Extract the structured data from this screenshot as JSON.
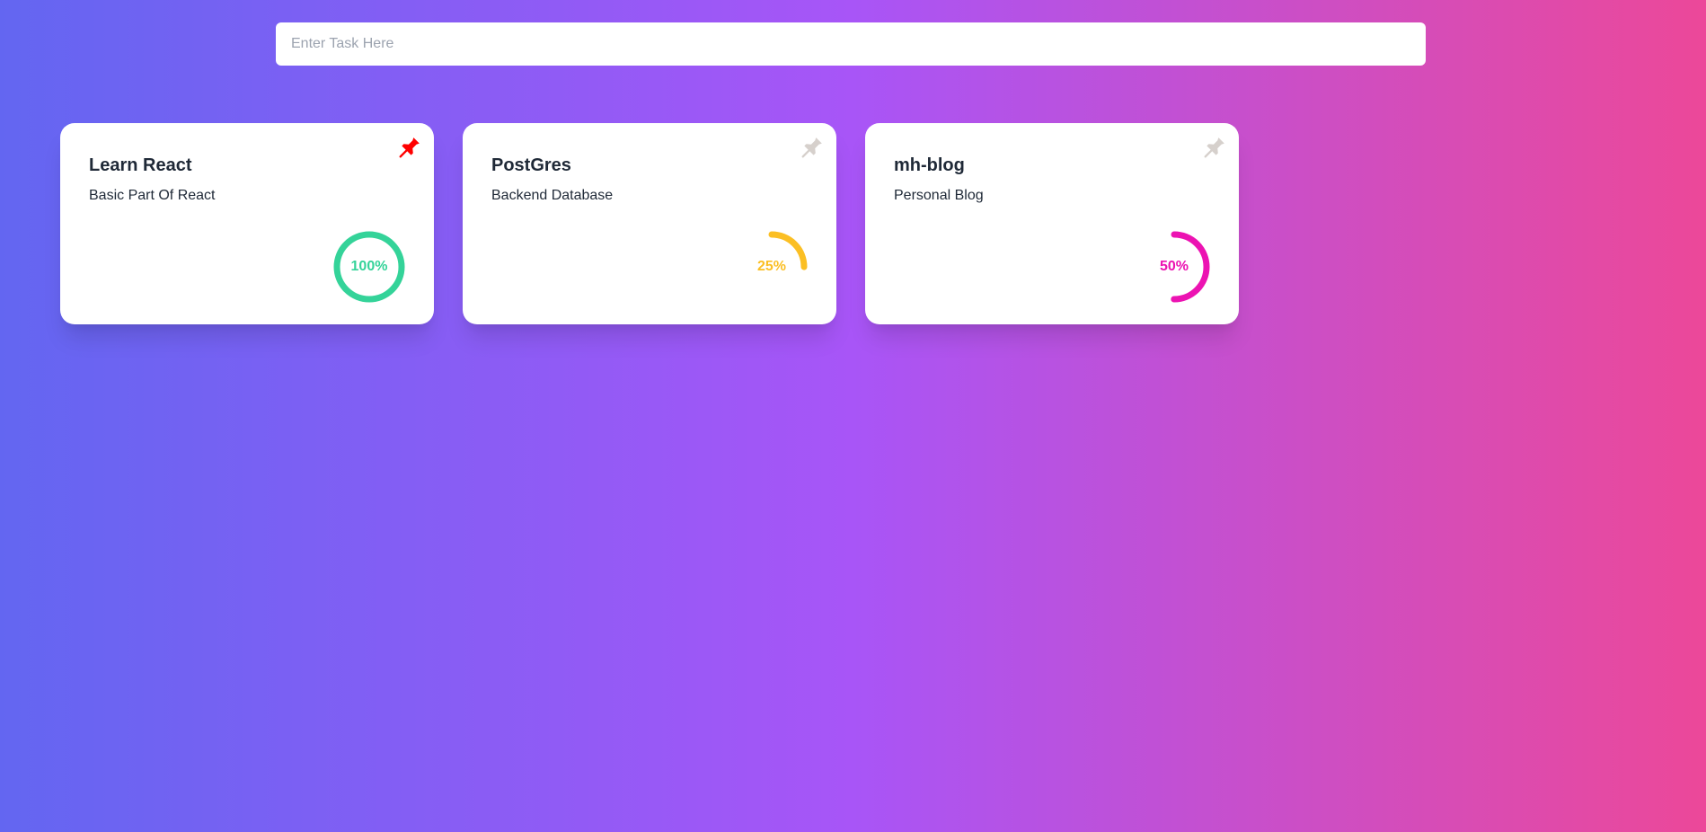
{
  "search": {
    "placeholder": "Enter Task Here",
    "value": ""
  },
  "cards": [
    {
      "title": "Learn React",
      "description": "Basic Part Of React",
      "pinned": true,
      "progress": 100,
      "progress_label": "100%",
      "color": "#34d399",
      "pin_color": "#ff0000",
      "pin_icon": "pushpin-icon"
    },
    {
      "title": "PostGres",
      "description": "Backend Database",
      "pinned": false,
      "progress": 25,
      "progress_label": "25%",
      "color": "#fbbf24",
      "pin_color": "#d6d0cc",
      "pin_icon": "pushpin-icon"
    },
    {
      "title": "mh-blog",
      "description": "Personal Blog",
      "pinned": false,
      "progress": 50,
      "progress_label": "50%",
      "color": "#ec13b2",
      "pin_color": "#d6d0cc",
      "pin_icon": "pushpin-icon"
    }
  ]
}
